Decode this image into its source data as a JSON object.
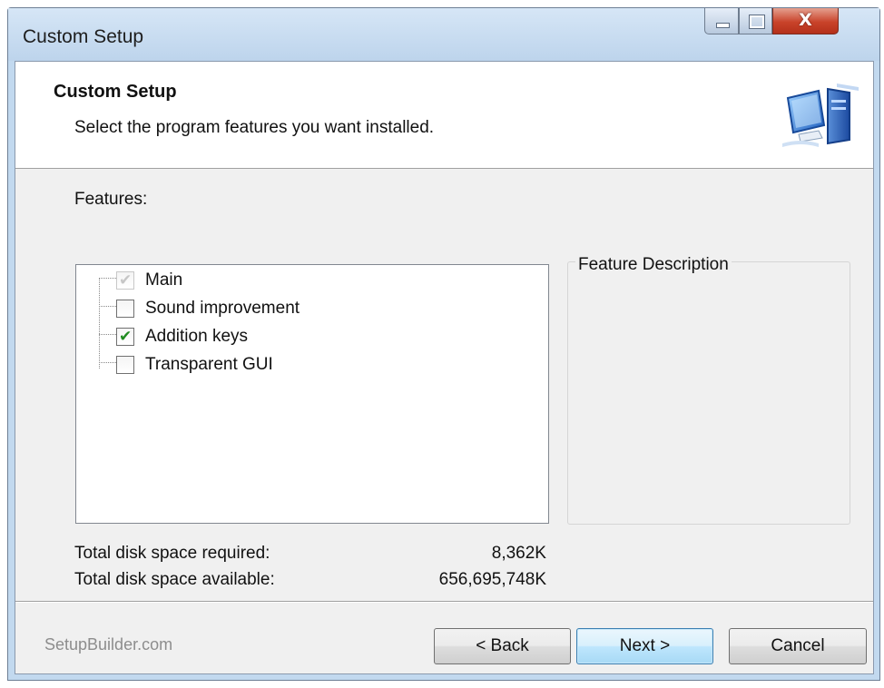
{
  "window": {
    "title": "Custom Setup",
    "controls": {
      "minimize": "minimize",
      "maximize": "maximize",
      "close": "X"
    }
  },
  "header": {
    "title": "Custom Setup",
    "subtitle": "Select the program features you want installed.",
    "image_icon": "computer-icon"
  },
  "features": {
    "label": "Features:",
    "items": [
      {
        "label": "Main",
        "checked": true,
        "disabled": true
      },
      {
        "label": "Sound improvement",
        "checked": false,
        "disabled": false
      },
      {
        "label": "Addition keys",
        "checked": true,
        "disabled": false
      },
      {
        "label": "Transparent GUI",
        "checked": false,
        "disabled": false
      }
    ]
  },
  "description": {
    "label": "Feature Description"
  },
  "disk": {
    "required_label": "Total disk space required:",
    "required_value": "8,362K",
    "available_label": "Total disk space available:",
    "available_value": "656,695,748K"
  },
  "footer": {
    "brand": "SetupBuilder.com",
    "back_label": "< Back",
    "next_label": "Next >",
    "cancel_label": "Cancel"
  },
  "colors": {
    "window_frame": "#c2d9ef",
    "client_bg": "#f0f0f0",
    "check_green": "#1f8a1f",
    "close_red": "#c9432a",
    "default_button_border": "#3c7fb1"
  }
}
